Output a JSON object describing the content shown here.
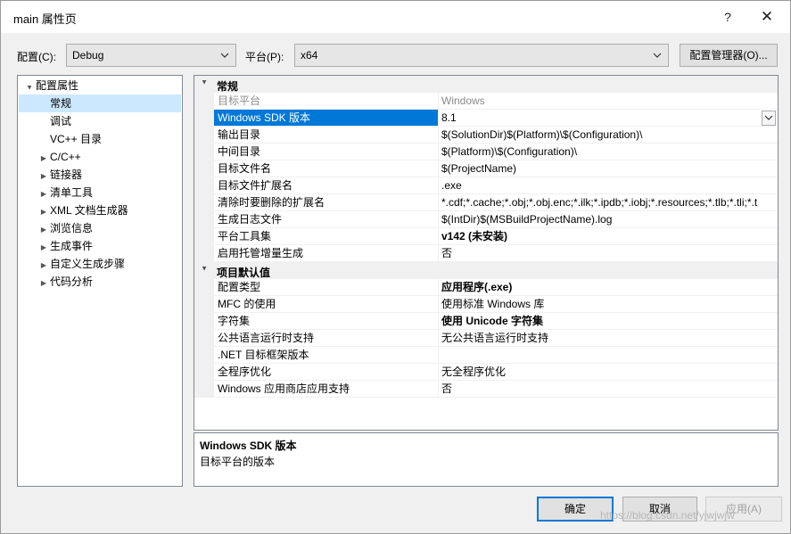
{
  "window": {
    "title": "main 属性页",
    "help": "?",
    "close": "✕"
  },
  "toolbar": {
    "config_label": "配置(C):",
    "config_value": "Debug",
    "platform_label": "平台(P):",
    "platform_value": "x64",
    "config_manager": "配置管理器(O)..."
  },
  "tree": {
    "root": "配置属性",
    "items": [
      {
        "label": "常规",
        "expandable": false,
        "selected": true
      },
      {
        "label": "调试",
        "expandable": false
      },
      {
        "label": "VC++ 目录",
        "expandable": false
      },
      {
        "label": "C/C++",
        "expandable": true
      },
      {
        "label": "链接器",
        "expandable": true
      },
      {
        "label": "清单工具",
        "expandable": true
      },
      {
        "label": "XML 文档生成器",
        "expandable": true
      },
      {
        "label": "浏览信息",
        "expandable": true
      },
      {
        "label": "生成事件",
        "expandable": true
      },
      {
        "label": "自定义生成步骤",
        "expandable": true
      },
      {
        "label": "代码分析",
        "expandable": true
      }
    ]
  },
  "grid": {
    "categories": [
      {
        "label": "常规",
        "rows": [
          {
            "name": "目标平台",
            "value": "Windows",
            "disabled": true
          },
          {
            "name": "Windows SDK 版本",
            "value": "8.1",
            "selected": true,
            "dropdown": true
          },
          {
            "name": "输出目录",
            "value": "$(SolutionDir)$(Platform)\\$(Configuration)\\"
          },
          {
            "name": "中间目录",
            "value": "$(Platform)\\$(Configuration)\\"
          },
          {
            "name": "目标文件名",
            "value": "$(ProjectName)"
          },
          {
            "name": "目标文件扩展名",
            "value": ".exe"
          },
          {
            "name": "清除时要删除的扩展名",
            "value": "*.cdf;*.cache;*.obj;*.obj.enc;*.ilk;*.ipdb;*.iobj;*.resources;*.tlb;*.tli;*.t"
          },
          {
            "name": "生成日志文件",
            "value": "$(IntDir)$(MSBuildProjectName).log"
          },
          {
            "name": "平台工具集",
            "value": "v142 (未安装)",
            "bold": true
          },
          {
            "name": "启用托管增量生成",
            "value": "否"
          }
        ]
      },
      {
        "label": "项目默认值",
        "rows": [
          {
            "name": "配置类型",
            "value": "应用程序(.exe)",
            "bold": true
          },
          {
            "name": "MFC 的使用",
            "value": "使用标准 Windows 库"
          },
          {
            "name": "字符集",
            "value": "使用 Unicode 字符集",
            "bold": true
          },
          {
            "name": "公共语言运行时支持",
            "value": "无公共语言运行时支持"
          },
          {
            "name": ".NET 目标框架版本",
            "value": ""
          },
          {
            "name": "全程序优化",
            "value": "无全程序优化"
          },
          {
            "name": "Windows 应用商店应用支持",
            "value": "否"
          }
        ]
      }
    ]
  },
  "description": {
    "title": "Windows SDK 版本",
    "text": "目标平台的版本"
  },
  "buttons": {
    "ok": "确定",
    "cancel": "取消",
    "apply": "应用(A)"
  },
  "watermark": "https://blog.csdn.net/yjwjwjw",
  "icons": {
    "expanded": "▲",
    "collapsed": "▶",
    "dropdown": "⌵"
  }
}
